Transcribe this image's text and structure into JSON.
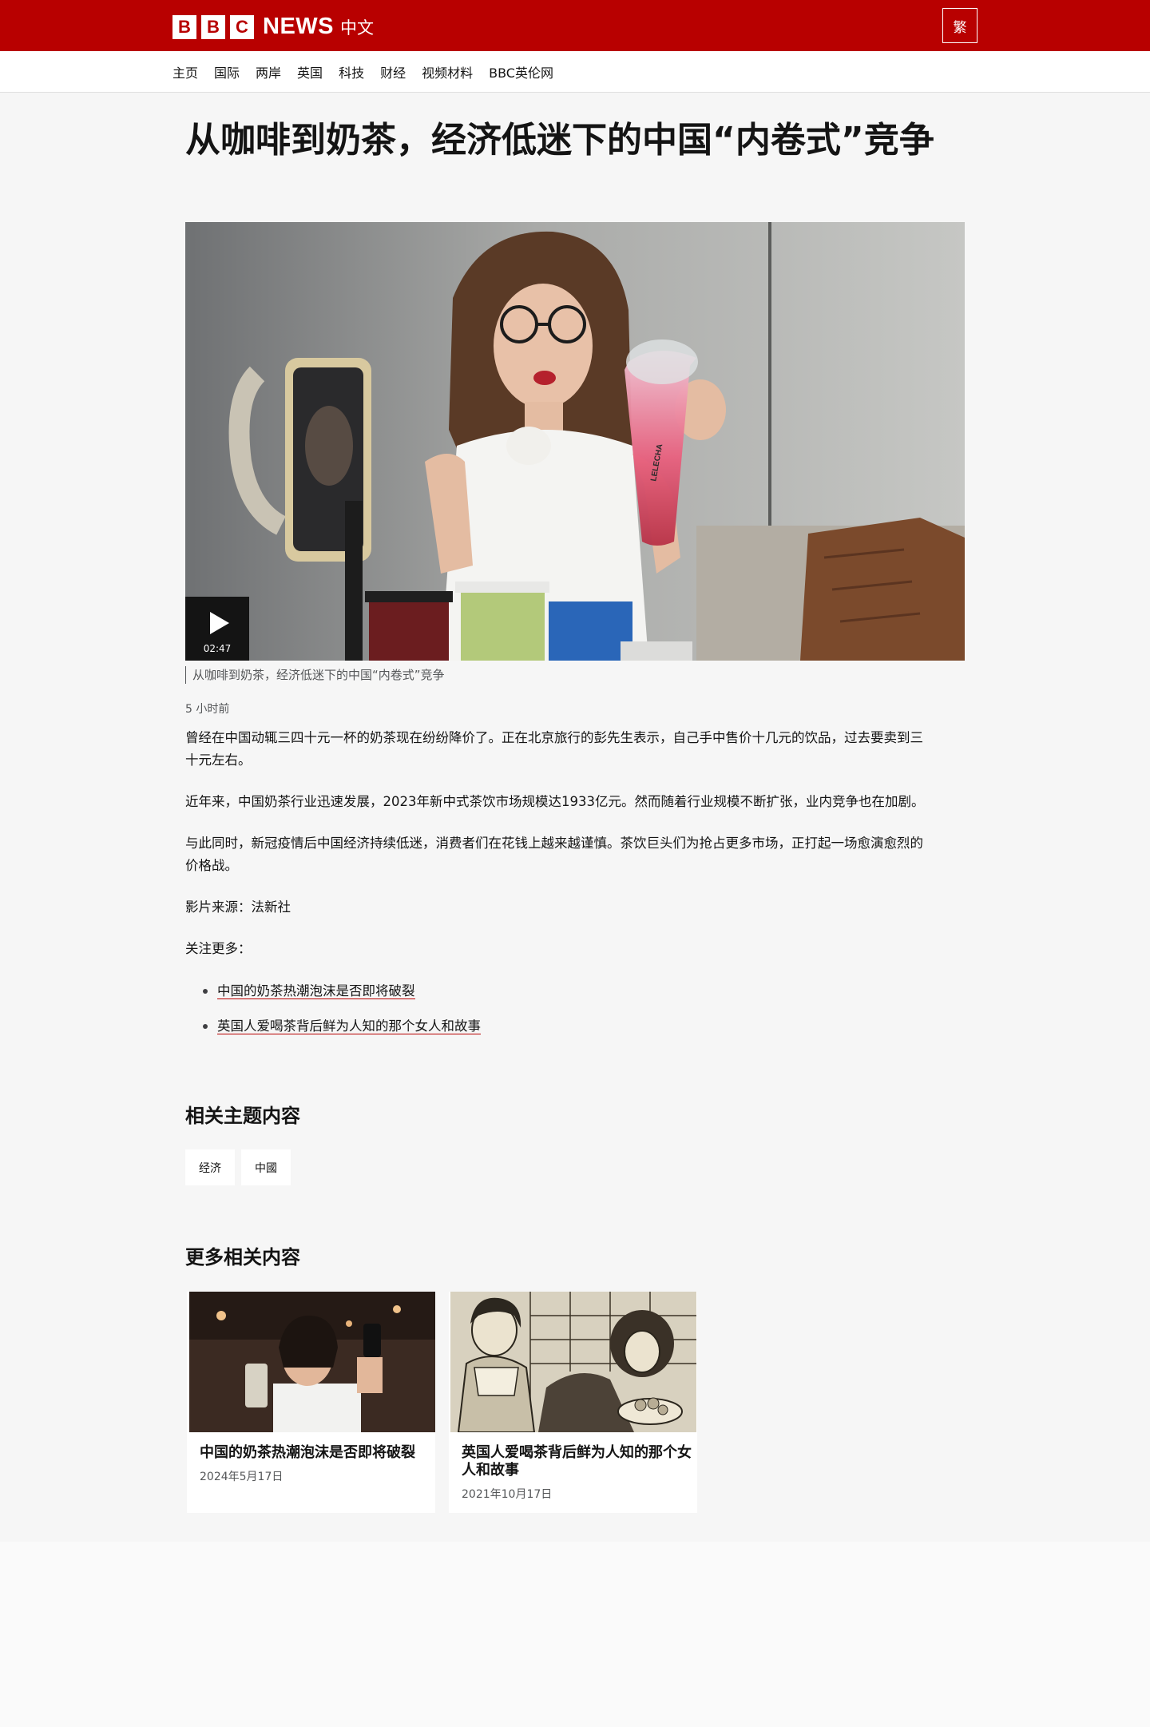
{
  "header": {
    "brand_letters": [
      "B",
      "B",
      "C"
    ],
    "brand_word": "NEWS",
    "brand_sub": "中文",
    "trad_toggle": "繁"
  },
  "nav": {
    "items": [
      "主页",
      "国际",
      "两岸",
      "英国",
      "科技",
      "财经",
      "视频材料",
      "BBC英伦网"
    ]
  },
  "article": {
    "headline": "从咖啡到奶茶，经济低迷下的中国“内卷式”竞争",
    "video": {
      "duration": "02:47",
      "cup_brand": "LELECHA"
    },
    "caption": "从咖啡到奶茶，经济低迷下的中国“内卷式”竞争",
    "timestamp": "5 小时前",
    "paragraphs": [
      "曾经在中国动辄三四十元一杯的奶茶现在纷纷降价了。正在北京旅行的彭先生表示，自己手中售价十几元的饮品，过去要卖到三十元左右。",
      "近年来，中国奶茶行业迅速发展，2023年新中式茶饮市场规模达1933亿元。然而随着行业规模不断扩张，业内竞争也在加剧。",
      "与此同时，新冠疫情后中国经济持续低迷，消费者们在花钱上越来越谨慎。茶饮巨头们为抢占更多市场，正打起一场愈演愈烈的价格战。",
      "影片来源：法新社",
      "关注更多："
    ],
    "links": [
      "中国的奶茶热潮泡沫是否即将破裂",
      "英国人爱喝茶背后鲜为人知的那个女人和故事"
    ]
  },
  "related_topics": {
    "heading": "相关主题内容",
    "tags": [
      "经济",
      "中國"
    ]
  },
  "more_related": {
    "heading": "更多相关内容",
    "cards": [
      {
        "title": "中国的奶茶热潮泡沫是否即将破裂",
        "date": "2024年5月17日"
      },
      {
        "title": "英国人爱喝茶背后鲜为人知的那个女人和故事",
        "date": "2021年10月17日"
      }
    ]
  },
  "colors": {
    "brand_red": "#b80000",
    "page_bg": "#f6f6f6",
    "text": "#141414",
    "muted": "#545658"
  }
}
